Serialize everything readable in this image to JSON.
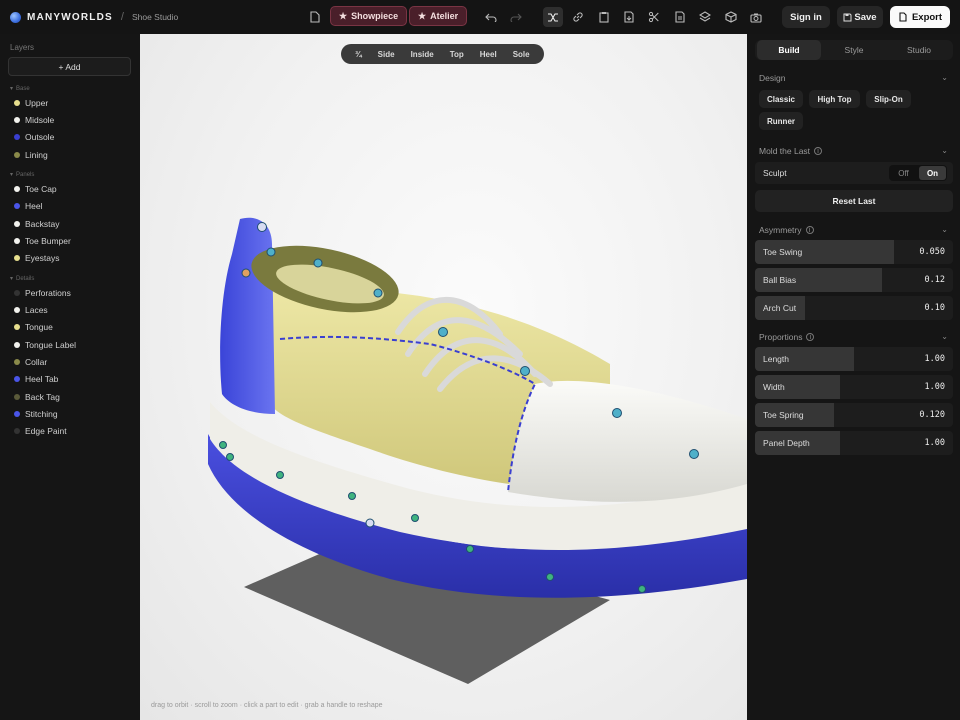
{
  "app": {
    "brand": "MANYWORLDS",
    "separator": "/",
    "project": "Shoe Studio"
  },
  "toolbar": {
    "showpiece_label": "Showpiece",
    "atelier_label": "Atelier",
    "sign_in_label": "Sign in",
    "save_label": "Save",
    "export_label": "Export"
  },
  "layers": {
    "title": "Layers",
    "add_label": "+ Add",
    "groups": [
      {
        "name": "Base",
        "items": [
          {
            "label": "Upper",
            "color": "#e7df8e"
          },
          {
            "label": "Midsole",
            "color": "#f2f2ee"
          },
          {
            "label": "Outsole",
            "color": "#3a3fd0"
          },
          {
            "label": "Lining",
            "color": "#8a8a4a"
          }
        ]
      },
      {
        "name": "Panels",
        "items": [
          {
            "label": "Toe Cap",
            "color": "#f2f2ee"
          },
          {
            "label": "Heel",
            "color": "#4a55e8"
          },
          {
            "label": "Backstay",
            "color": "#f2f2ee"
          },
          {
            "label": "Toe Bumper",
            "color": "#f2f2ee"
          },
          {
            "label": "Eyestays",
            "color": "#e7df8e"
          }
        ]
      },
      {
        "name": "Details",
        "items": [
          {
            "label": "Perforations",
            "color": "#333333"
          },
          {
            "label": "Laces",
            "color": "#f2f2ee"
          },
          {
            "label": "Tongue",
            "color": "#e7df8e"
          },
          {
            "label": "Tongue Label",
            "color": "#f2f2ee"
          },
          {
            "label": "Collar",
            "color": "#8a8a4a"
          },
          {
            "label": "Heel Tab",
            "color": "#4a55e8"
          },
          {
            "label": "Back Tag",
            "color": "#5a5a3a"
          },
          {
            "label": "Stitching",
            "color": "#4a55e8"
          },
          {
            "label": "Edge Paint",
            "color": "#333333"
          }
        ]
      }
    ]
  },
  "viewport": {
    "tabs": [
      "¾",
      "Side",
      "Inside",
      "Top",
      "Heel",
      "Sole"
    ],
    "hint": "drag to orbit · scroll to zoom · click a part to edit · grab a handle to reshape"
  },
  "panel": {
    "tabs": [
      "Build",
      "Style",
      "Studio"
    ],
    "active_tab": "Build",
    "design": {
      "title": "Design",
      "options": [
        "Classic",
        "High Top",
        "Slip-On",
        "Runner"
      ]
    },
    "mold": {
      "title": "Mold the Last",
      "sculpt_label": "Sculpt",
      "off_label": "Off",
      "on_label": "On",
      "sculpt_state": "On",
      "reset_label": "Reset Last"
    },
    "asymmetry": {
      "title": "Asymmetry",
      "sliders": [
        {
          "label": "Toe Swing",
          "value": "0.050",
          "level": 0.7
        },
        {
          "label": "Ball Bias",
          "value": "0.12",
          "level": 0.64
        },
        {
          "label": "Arch Cut",
          "value": "0.10",
          "level": 0.25
        }
      ]
    },
    "proportions": {
      "title": "Proportions",
      "sliders": [
        {
          "label": "Length",
          "value": "1.00",
          "level": 0.5
        },
        {
          "label": "Width",
          "value": "1.00",
          "level": 0.43
        },
        {
          "label": "Toe Spring",
          "value": "0.120",
          "level": 0.4
        },
        {
          "label": "Panel Depth",
          "value": "1.00",
          "level": 0.43
        }
      ]
    }
  }
}
